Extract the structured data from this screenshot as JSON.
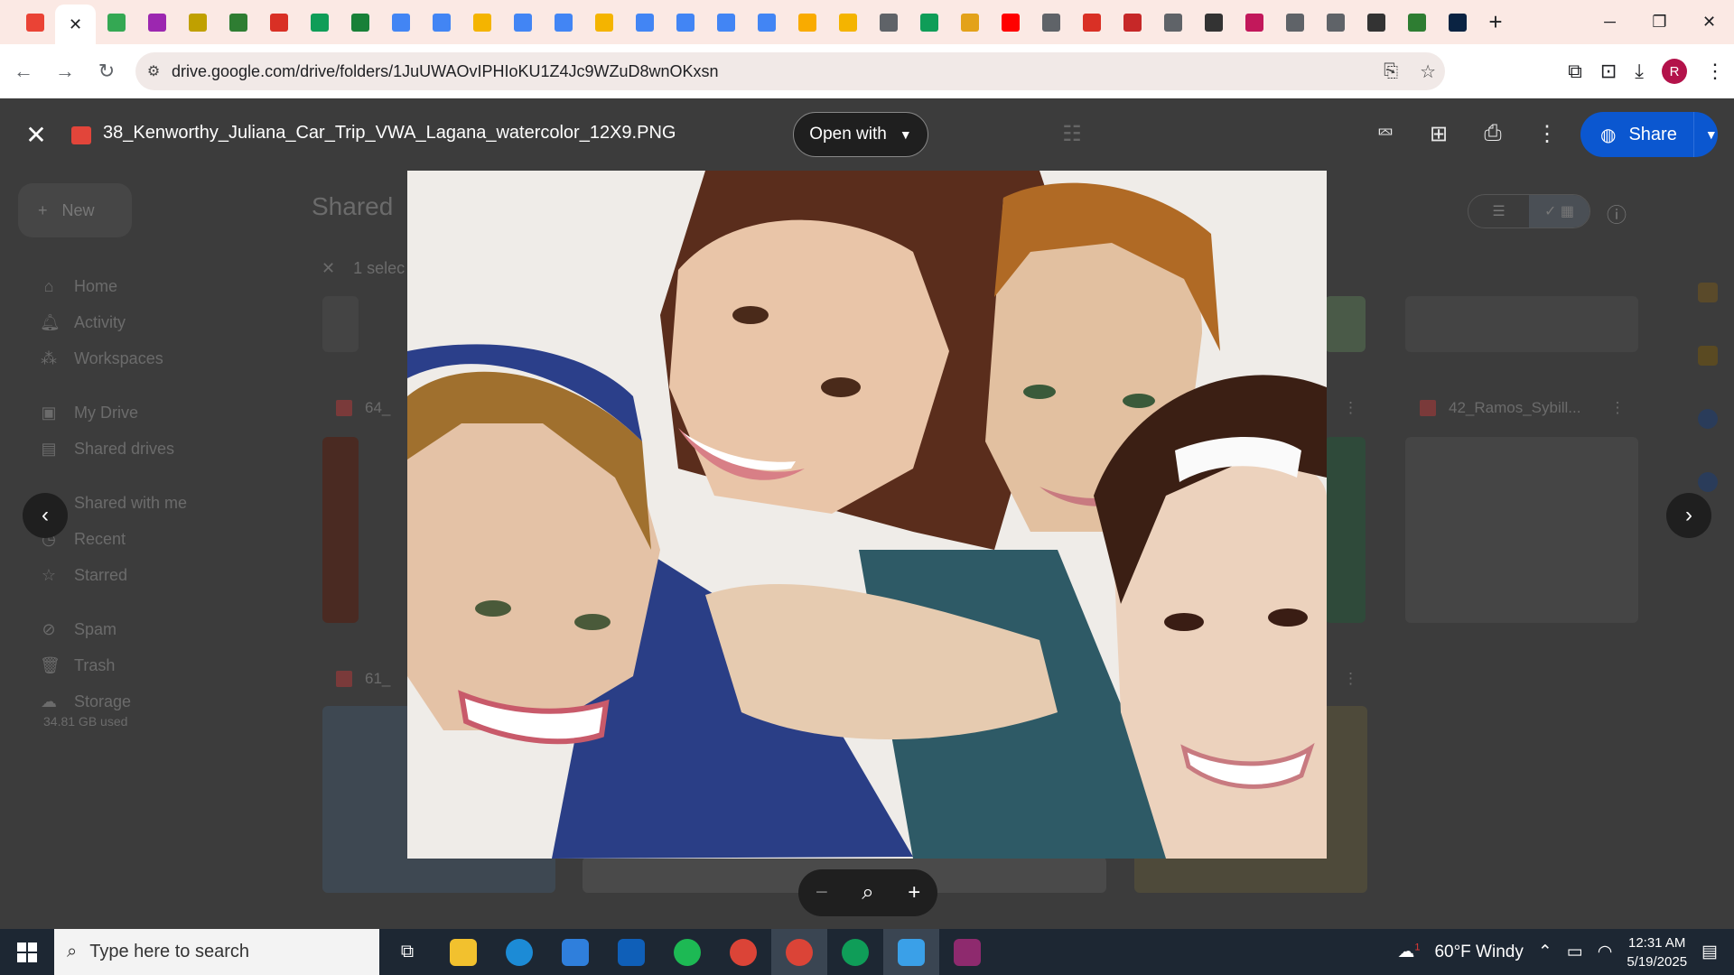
{
  "browser": {
    "tab_colors": [
      "#ea4335",
      "#fff",
      "#34a853",
      "#9c27b0",
      "#c0a000",
      "#2e7d32",
      "#d93025",
      "#0f9d58",
      "#188038",
      "#4285f4",
      "#4285f4",
      "#f4b400",
      "#4285f4",
      "#4285f4",
      "#f4b400",
      "#4285f4",
      "#4285f4",
      "#4285f4",
      "#4285f4",
      "#f9ab00",
      "#f4b400",
      "#5f6368",
      "#0f9d58",
      "#e3a21a",
      "#ff0000",
      "#5f6368",
      "#d93025",
      "#c62828",
      "#5f6368",
      "#333",
      "#c2185b",
      "#5f6368",
      "#5f6368",
      "#333",
      "#2e7d32",
      "#0a2342"
    ],
    "active_tab_close": "✕",
    "new_tab": "+",
    "url": "drive.google.com/drive/folders/1JuUWAOvIPHIoKU1Z4Jc9WZuD8wnOKxsn",
    "profile_initial": "R"
  },
  "drive": {
    "new_label": "New",
    "page_title": "Shared",
    "selection_text": "1 selec",
    "sidebar": [
      {
        "label": "Home",
        "icon": "home-icon"
      },
      {
        "label": "Activity",
        "icon": "bell-icon"
      },
      {
        "label": "Workspaces",
        "icon": "workspaces-icon"
      },
      {
        "label": "My Drive",
        "icon": "drive-icon"
      },
      {
        "label": "Shared drives",
        "icon": "shared-drives-icon"
      },
      {
        "label": "Shared with me",
        "icon": "people-icon"
      },
      {
        "label": "Recent",
        "icon": "clock-icon"
      },
      {
        "label": "Starred",
        "icon": "star-icon"
      },
      {
        "label": "Spam",
        "icon": "spam-icon"
      },
      {
        "label": "Trash",
        "icon": "trash-icon"
      },
      {
        "label": "Storage",
        "icon": "cloud-icon"
      }
    ],
    "storage_used": "34.81 GB used",
    "cards": [
      {
        "label": "64_"
      },
      {
        "label": "42_Ramos_Sybill..."
      },
      {
        "label": "61_"
      }
    ]
  },
  "viewer": {
    "file_name": "38_Kenworthy_Juliana_Car_Trip_VWA_Lagana_watercolor_12X9.PNG",
    "open_with": "Open with",
    "share": "Share"
  },
  "taskbar": {
    "search_placeholder": "Type here to search",
    "weather": "60°F  Windy",
    "time": "12:31 AM",
    "date": "5/19/2025",
    "notification_count": "1"
  }
}
